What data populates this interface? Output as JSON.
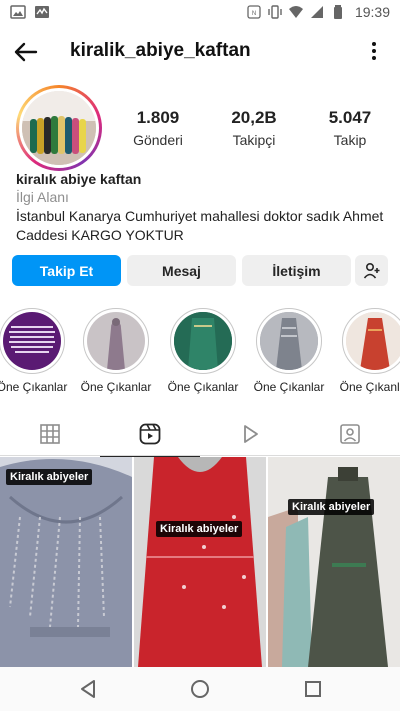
{
  "status_bar": {
    "time": "19:39",
    "left_icons": [
      "image-icon",
      "activity-icon"
    ],
    "right_icons": [
      "nfc-icon",
      "vibrate-icon",
      "wifi-icon",
      "signal-icon",
      "battery-icon"
    ]
  },
  "header": {
    "username": "kiralik_abiye_kaftan"
  },
  "profile": {
    "stats": [
      {
        "value": "1.809",
        "label": "Gönderi"
      },
      {
        "value": "20,2B",
        "label": "Takipçi"
      },
      {
        "value": "5.047",
        "label": "Takip"
      }
    ],
    "name": "kiralık abiye kaftan",
    "category": "İlgi Alanı",
    "bio": "İstanbul Kanarya  Cumhuriyet mahallesi doktor sadık Ahmet Caddesi KARGO YOKTUR"
  },
  "buttons": {
    "follow": "Takip Et",
    "message": "Mesaj",
    "contact": "İletişim"
  },
  "highlights": [
    {
      "label": "Öne Çıkanlar"
    },
    {
      "label": "Öne Çıkanlar"
    },
    {
      "label": "Öne Çıkanlar"
    },
    {
      "label": "Öne Çıkanlar"
    },
    {
      "label": "Öne Çıkanlar"
    }
  ],
  "posts": [
    {
      "tag": "Kiralık abiyeler"
    },
    {
      "tag": "Kiralık abiyeler"
    },
    {
      "tag": "Kiralık abiyeler"
    }
  ],
  "colors": {
    "accent": "#0095f6",
    "secondary_button": "#efefef",
    "muted_text": "#8e8e8e"
  }
}
